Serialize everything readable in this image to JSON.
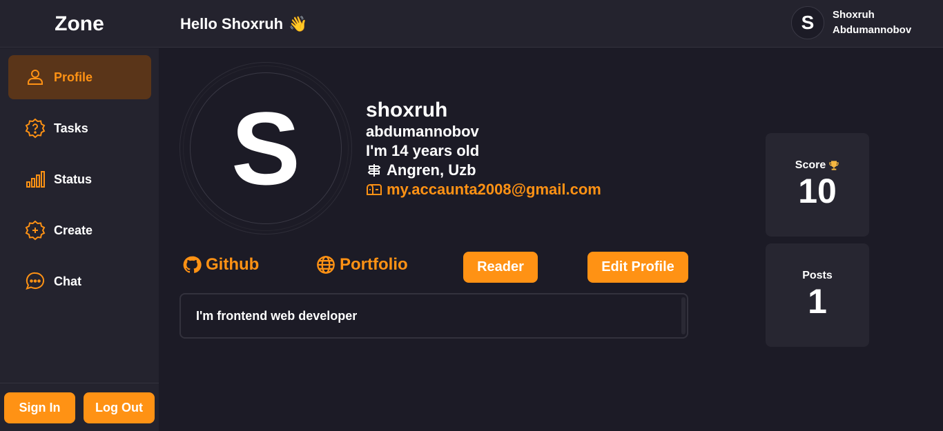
{
  "app": {
    "logo": "Zone"
  },
  "header": {
    "greeting": "Hello Shoxruh",
    "wave_emoji": "👋",
    "user_initial": "S",
    "user_first": "Shoxruh",
    "user_last": "Abdumannobov"
  },
  "sidebar": {
    "items": [
      {
        "label": "Profile",
        "icon": "user-icon",
        "active": true
      },
      {
        "label": "Tasks",
        "icon": "question-icon",
        "active": false
      },
      {
        "label": "Status",
        "icon": "bar-chart-icon",
        "active": false
      },
      {
        "label": "Create",
        "icon": "plus-circle-icon",
        "active": false
      },
      {
        "label": "Chat",
        "icon": "chat-icon",
        "active": false
      }
    ],
    "sign_in": "Sign In",
    "log_out": "Log Out"
  },
  "profile": {
    "avatar_initial": "S",
    "first_name": "shoxruh",
    "last_name": "abdumannobov",
    "age": "I'm 14 years old",
    "location": "Angren, Uzb",
    "email": "my.accaunta2008@gmail.com",
    "github": "Github",
    "portfolio": "Portfolio",
    "reader_button": "Reader",
    "edit_button": "Edit Profile",
    "bio": "I'm frontend web developer"
  },
  "stats": {
    "score_label": "Score",
    "score_value": "10",
    "posts_label": "Posts",
    "posts_value": "1"
  },
  "colors": {
    "accent": "#ff9214",
    "background": "#1c1b26",
    "panel": "#24232e",
    "active_nav": "#5a3519"
  }
}
